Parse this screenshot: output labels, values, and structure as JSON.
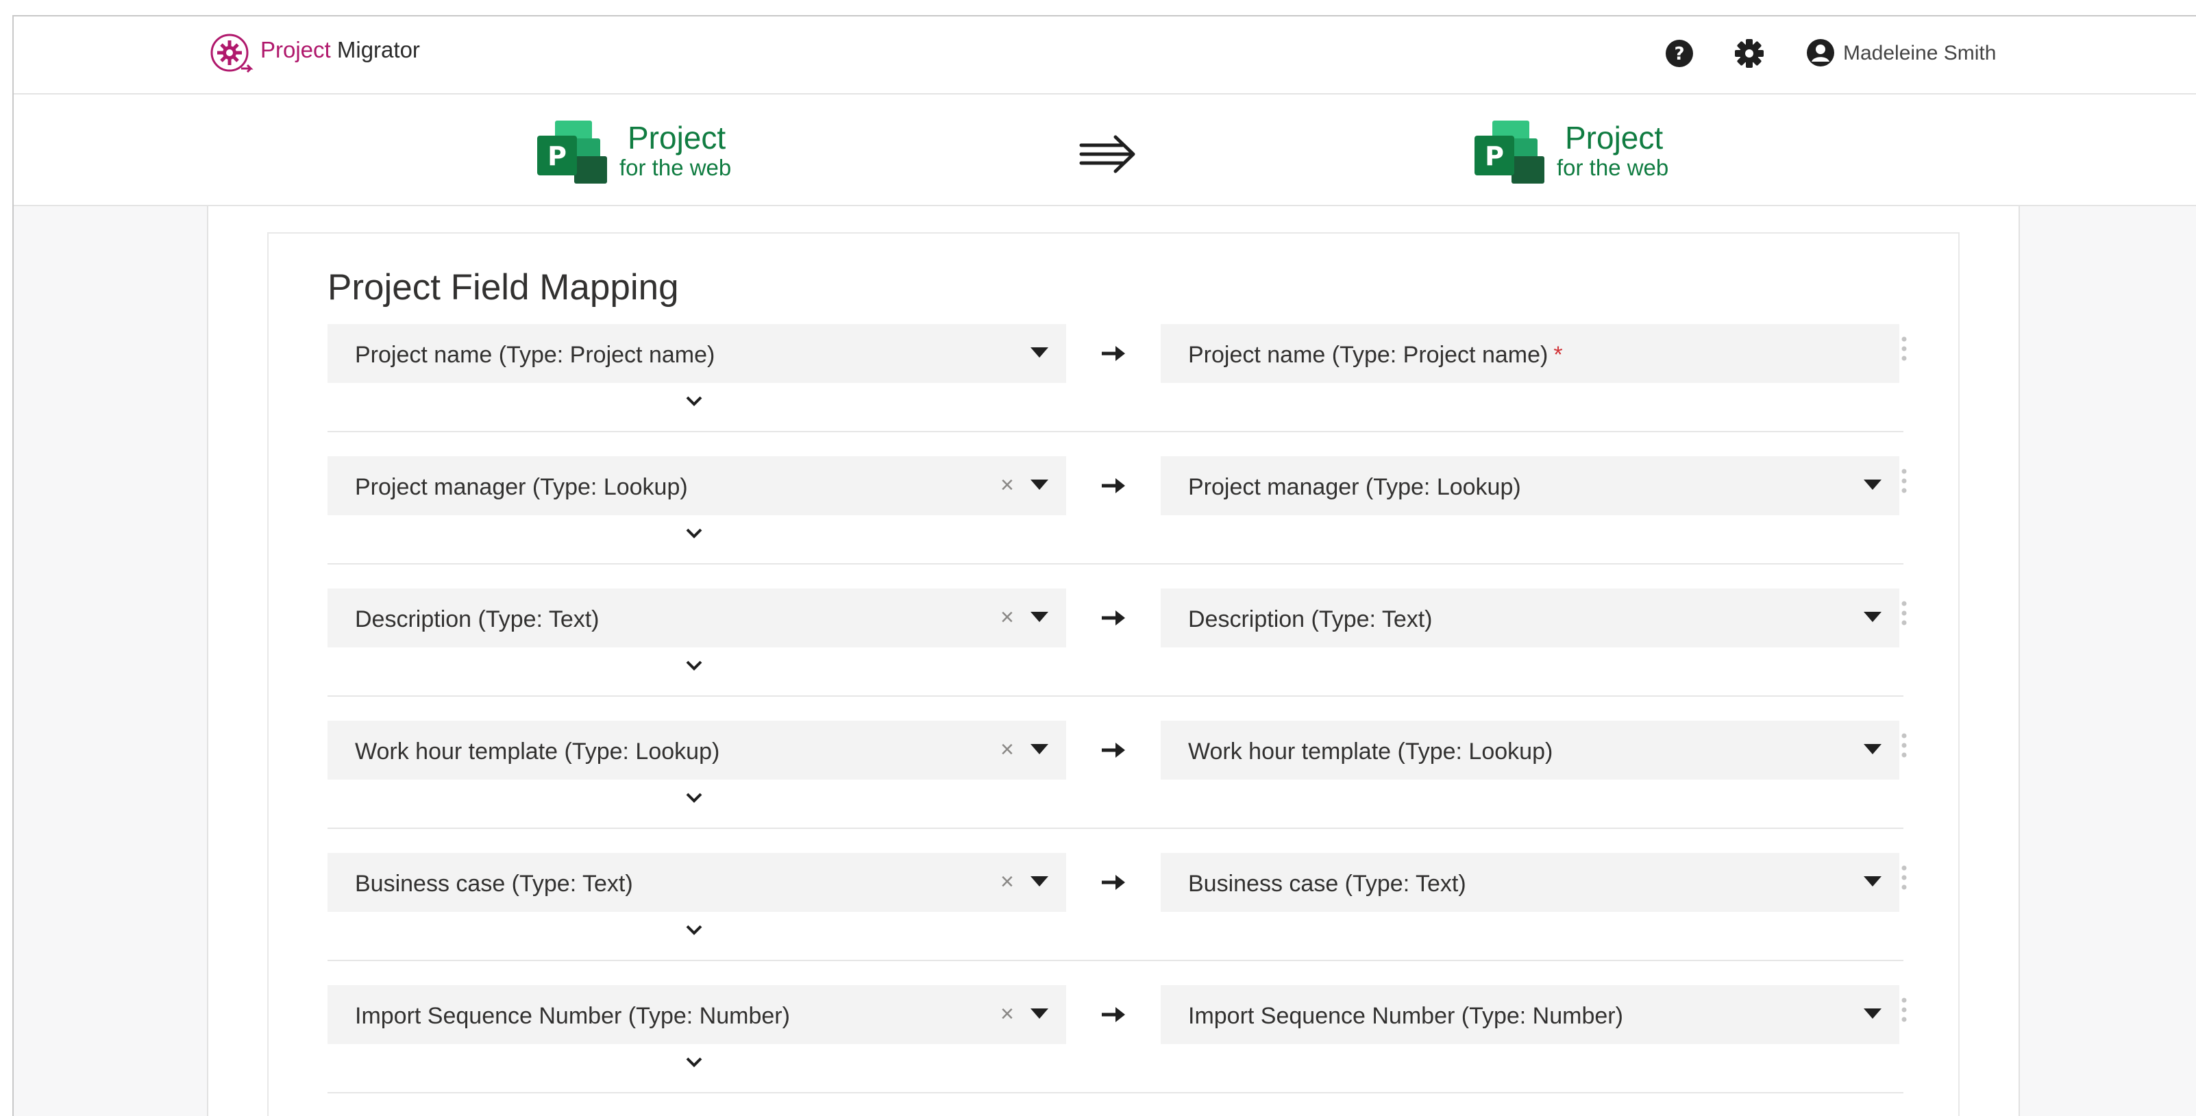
{
  "app": {
    "title_part1": "Project",
    "title_part2": " Migrator",
    "brand_color": "#b0186c",
    "icons": [
      "help-icon",
      "gear-icon",
      "user-avatar-icon"
    ]
  },
  "user": {
    "name": "Madeleine Smith"
  },
  "migration": {
    "source": {
      "name": "Project",
      "subtitle": "for the web"
    },
    "destination": {
      "name": "Project",
      "subtitle": "for the web"
    },
    "product_color": "#107c41",
    "arrow_icon": "triple-right-arrow-icon"
  },
  "mapping": {
    "title": "Project Field Mapping",
    "rows": [
      {
        "source": "Project name (Type: Project name)",
        "target": "Project name (Type: Project name)",
        "required_mark": "*",
        "clearable": false,
        "target_dropdown": false
      },
      {
        "source": "Project manager (Type: Lookup)",
        "target": "Project manager (Type: Lookup)",
        "clear_glyph": "×",
        "clearable": true,
        "target_dropdown": true
      },
      {
        "source": "Description (Type: Text)",
        "target": "Description (Type: Text)",
        "clear_glyph": "×",
        "clearable": true,
        "target_dropdown": true
      },
      {
        "source": "Work hour template (Type: Lookup)",
        "target": "Work hour template (Type: Lookup)",
        "clear_glyph": "×",
        "clearable": true,
        "target_dropdown": true
      },
      {
        "source": "Business case (Type: Text)",
        "target": "Business case (Type: Text)",
        "clear_glyph": "×",
        "clearable": true,
        "target_dropdown": true
      },
      {
        "source": "Import Sequence Number (Type: Number)",
        "target": "Import Sequence Number (Type: Number)",
        "clear_glyph": "×",
        "clearable": true,
        "target_dropdown": true
      }
    ]
  }
}
